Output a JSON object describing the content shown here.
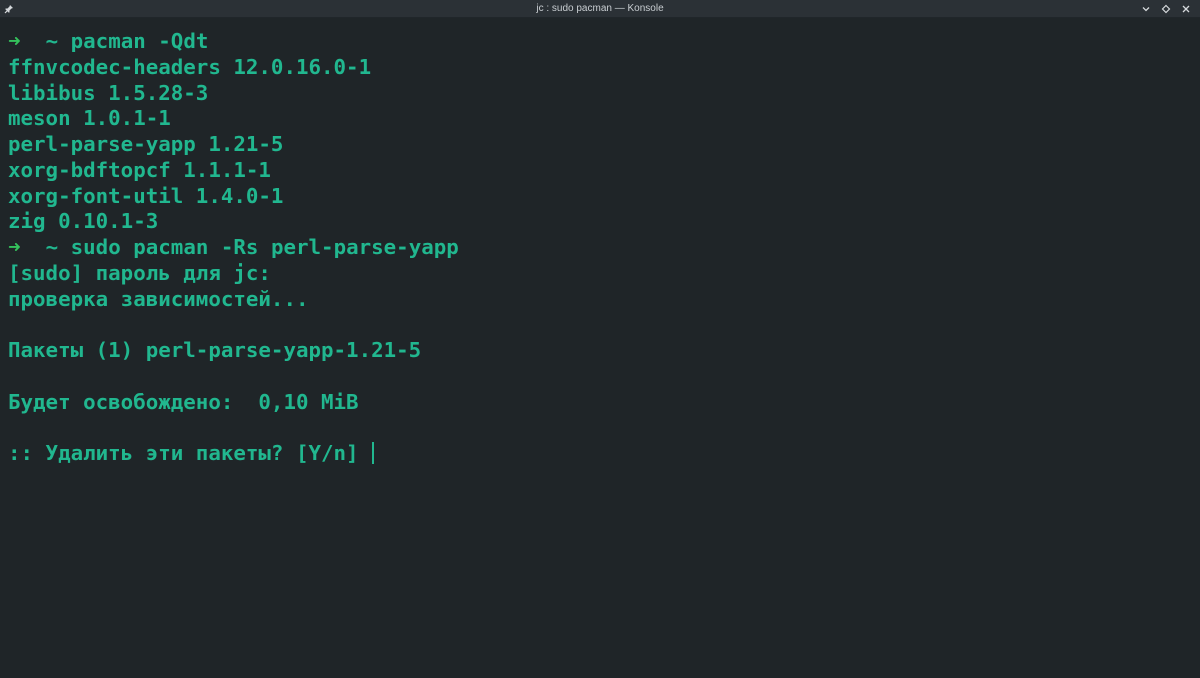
{
  "window": {
    "title": "jc : sudo pacman — Konsole",
    "controls": [
      "chevron-down-icon",
      "maximize-icon",
      "close-icon"
    ]
  },
  "colors": {
    "background": "#1f2528",
    "titlebar": "#2b3136",
    "text": "#21b78f",
    "prompt_arrow": "#34c25c"
  },
  "terminal": {
    "lines": [
      {
        "type": "prompt",
        "arrow": "➜",
        "cwd": "~",
        "command": "pacman -Qdt"
      },
      {
        "type": "output",
        "text": "ffnvcodec-headers 12.0.16.0-1"
      },
      {
        "type": "output",
        "text": "libibus 1.5.28-3"
      },
      {
        "type": "output",
        "text": "meson 1.0.1-1"
      },
      {
        "type": "output",
        "text": "perl-parse-yapp 1.21-5"
      },
      {
        "type": "output",
        "text": "xorg-bdftopcf 1.1.1-1"
      },
      {
        "type": "output",
        "text": "xorg-font-util 1.4.0-1"
      },
      {
        "type": "output",
        "text": "zig 0.10.1-3"
      },
      {
        "type": "prompt",
        "arrow": "➜",
        "cwd": "~",
        "command": "sudo pacman -Rs perl-parse-yapp"
      },
      {
        "type": "output",
        "text": "[sudo] пароль для jc:"
      },
      {
        "type": "output",
        "text": "проверка зависимостей..."
      },
      {
        "type": "output",
        "text": ""
      },
      {
        "type": "output",
        "text": "Пакеты (1) perl-parse-yapp-1.21-5"
      },
      {
        "type": "output",
        "text": ""
      },
      {
        "type": "output",
        "text": "Будет освобождено:  0,10 MiB"
      },
      {
        "type": "output",
        "text": ""
      },
      {
        "type": "input",
        "text": ":: Удалить эти пакеты? [Y/n] "
      }
    ]
  }
}
